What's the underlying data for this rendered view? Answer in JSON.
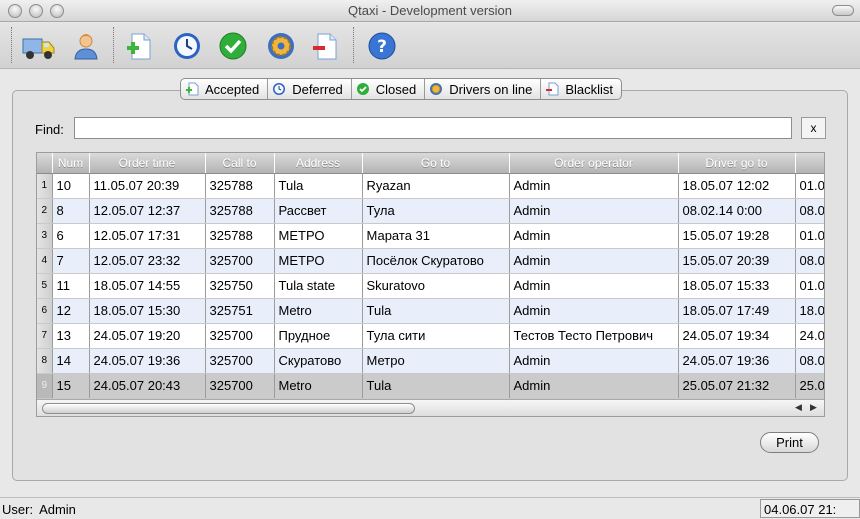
{
  "window": {
    "title": "Qtaxi - Development version"
  },
  "toolbar": {
    "buttons": [
      {
        "icon": "truck-icon"
      },
      {
        "icon": "user-icon"
      },
      {
        "icon": "new-document-icon"
      },
      {
        "icon": "clock-icon"
      },
      {
        "icon": "checkmark-icon"
      },
      {
        "icon": "gear-icon"
      },
      {
        "icon": "remove-document-icon"
      },
      {
        "icon": "help-icon"
      }
    ]
  },
  "tabs": [
    {
      "label": "Accepted",
      "icon": "accepted-icon"
    },
    {
      "label": "Deferred",
      "icon": "clock-icon"
    },
    {
      "label": "Closed",
      "icon": "checkmark-icon"
    },
    {
      "label": "Drivers on line",
      "icon": "gear-icon"
    },
    {
      "label": "Blacklist",
      "icon": "blacklist-icon"
    }
  ],
  "find": {
    "label": "Find:",
    "value": "",
    "clear_label": "x"
  },
  "table": {
    "columns": [
      "Num",
      "Order time",
      "Call to",
      "Address",
      "Go to",
      "Order operator",
      "Driver go to",
      ""
    ],
    "rows": [
      {
        "n": "1",
        "cells": [
          "10",
          "11.05.07 20:39",
          "325788",
          "Tula",
          "Ryazan",
          "Admin",
          "18.05.07 12:02",
          "01.0"
        ]
      },
      {
        "n": "2",
        "cells": [
          "8",
          "12.05.07 12:37",
          "325788",
          "Рассвет",
          "Тула",
          "Admin",
          "08.02.14 0:00",
          "08.0"
        ]
      },
      {
        "n": "3",
        "cells": [
          "6",
          "12.05.07 17:31",
          "325788",
          "МЕТРО",
          "Марата 31",
          "Admin",
          "15.05.07 19:28",
          "01.0"
        ]
      },
      {
        "n": "4",
        "cells": [
          "7",
          "12.05.07 23:32",
          "325700",
          "МЕТРО",
          "Посёлок Скуратово",
          "Admin",
          "15.05.07 20:39",
          "08.0"
        ]
      },
      {
        "n": "5",
        "cells": [
          "11",
          "18.05.07 14:55",
          "325750",
          "Tula state",
          "Skuratovo",
          "Admin",
          "18.05.07 15:33",
          "01.0"
        ]
      },
      {
        "n": "6",
        "cells": [
          "12",
          "18.05.07 15:30",
          "325751",
          "Metro",
          "Tula",
          "Admin",
          "18.05.07 17:49",
          "18.0"
        ]
      },
      {
        "n": "7",
        "cells": [
          "13",
          "24.05.07 19:20",
          "325700",
          "Прудное",
          "Тула сити",
          "Тестов Тесто Петрович",
          "24.05.07 19:34",
          "24.0"
        ]
      },
      {
        "n": "8",
        "cells": [
          "14",
          "24.05.07 19:36",
          "325700",
          "Скуратово",
          "Метро",
          "Admin",
          "24.05.07 19:36",
          "08.0"
        ]
      },
      {
        "n": "9",
        "cells": [
          "15",
          "24.05.07 20:43",
          "325700",
          "Metro",
          "Tula",
          "Admin",
          "25.05.07 21:32",
          "25.0"
        ]
      }
    ],
    "selected_row": 9
  },
  "actions": {
    "print_label": "Print"
  },
  "status": {
    "user_label": "User:",
    "user_value": "Admin",
    "datetime": "04.06.07 21:"
  }
}
